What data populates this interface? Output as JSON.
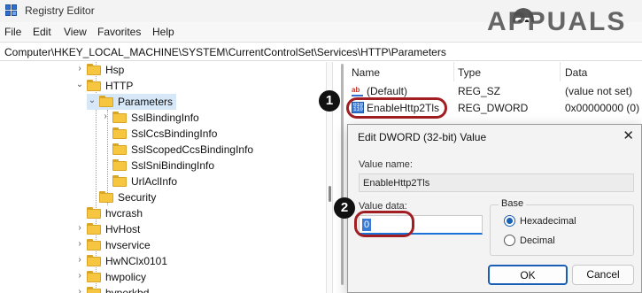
{
  "window": {
    "title": "Registry Editor"
  },
  "watermark": {
    "brand": "APPUALS"
  },
  "menu": [
    "File",
    "Edit",
    "View",
    "Favorites",
    "Help"
  ],
  "address": "Computer\\HKEY_LOCAL_MACHINE\\SYSTEM\\CurrentControlSet\\Services\\HTTP\\Parameters",
  "tree": {
    "items": [
      {
        "label": "Hsp",
        "expander": "collapsed"
      },
      {
        "label": "HTTP",
        "expander": "expanded"
      },
      {
        "label": "Parameters",
        "expander": "expanded",
        "selected": true
      },
      {
        "label": "SslBindingInfo",
        "expander": "collapsed"
      },
      {
        "label": "SslCcsBindingInfo",
        "expander": "none"
      },
      {
        "label": "SslScopedCcsBindingInfo",
        "expander": "none"
      },
      {
        "label": "SslSniBindingInfo",
        "expander": "none"
      },
      {
        "label": "UrlAclInfo",
        "expander": "none"
      },
      {
        "label": "Security",
        "expander": "none"
      },
      {
        "label": "hvcrash",
        "expander": "none"
      },
      {
        "label": "HvHost",
        "expander": "collapsed"
      },
      {
        "label": "hvservice",
        "expander": "collapsed"
      },
      {
        "label": "HwNClx0101",
        "expander": "collapsed"
      },
      {
        "label": "hwpolicy",
        "expander": "collapsed"
      },
      {
        "label": "hyperkbd",
        "expander": "collapsed"
      }
    ]
  },
  "values": {
    "columns": [
      "Name",
      "Type",
      "Data"
    ],
    "rows": [
      {
        "icon": "string-value-icon",
        "name": "(Default)",
        "type": "REG_SZ",
        "data": "(value not set)"
      },
      {
        "icon": "binary-value-icon",
        "name": "EnableHttp2Tls",
        "type": "REG_DWORD",
        "data": "0x00000000 (0)"
      }
    ]
  },
  "markers": [
    "1",
    "2"
  ],
  "dialog": {
    "title": "Edit DWORD (32-bit) Value",
    "close": "✕",
    "value_name_label": "Value name:",
    "value_name": "EnableHttp2Tls",
    "value_data_label": "Value data:",
    "value_data": "0",
    "base_label": "Base",
    "options": [
      {
        "label": "Hexadecimal",
        "selected": true
      },
      {
        "label": "Decimal",
        "selected": false
      }
    ],
    "ok": "OK",
    "cancel": "Cancel"
  },
  "colors": {
    "accent": "#1a5fb4",
    "annotation": "#a11e22",
    "folder": "#f7c640",
    "selection": "#d6e8f8"
  }
}
